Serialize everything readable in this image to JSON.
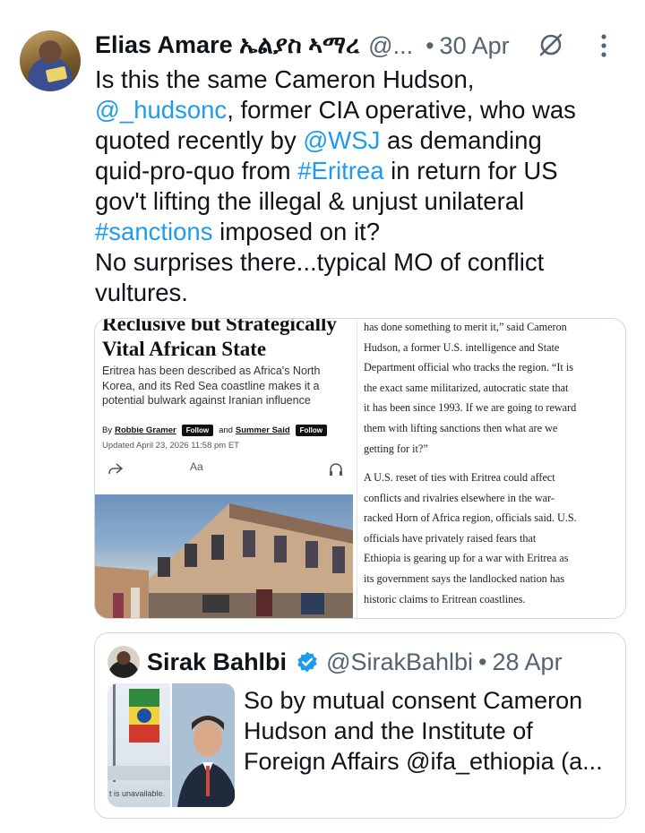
{
  "tweet": {
    "author_name": "Elias Amare ኤልያስ ኣማረ",
    "handle": "@...",
    "separator": "•",
    "date": "30 Apr",
    "text_lines": [
      [
        {
          "t": "Is this the same Cameron Hudson,",
          "link": false
        }
      ],
      [
        {
          "t": "@_hudsonc",
          "link": true
        },
        {
          "t": ", former CIA operative, who was",
          "link": false
        }
      ],
      [
        {
          "t": "quoted recently by ",
          "link": false
        },
        {
          "t": "@WSJ",
          "link": true
        },
        {
          "t": " as demanding",
          "link": false
        }
      ],
      [
        {
          "t": "quid-pro-quo from ",
          "link": false
        },
        {
          "t": "#Eritrea",
          "link": true
        },
        {
          "t": " in return for  US",
          "link": false
        }
      ],
      [
        {
          "t": "gov't lifting the illegal & unjust unilateral",
          "link": false
        }
      ],
      [
        {
          "t": "#sanctions",
          "link": true
        },
        {
          "t": " imposed on it?",
          "link": false
        }
      ],
      [
        {
          "t": "No surprises there...typical MO of conflict",
          "link": false
        }
      ],
      [
        {
          "t": "vultures.",
          "link": false
        }
      ]
    ],
    "link_color": "#1d9bf0"
  },
  "media": {
    "left": {
      "headline_lines": [
        "Reclusive but Strategically",
        "Vital African State"
      ],
      "dek": "Eritrea has been described as Africa's North Korea, and its Red Sea coastline makes it a potential bulwark against Iranian influence",
      "by_label": "By",
      "author1": "Robbie Gramer",
      "follow_label": "Follow",
      "and_label": "and",
      "author2": "Summer Said",
      "updated": "Updated April 23, 2026 11:58 pm ET",
      "text_size_label": "Aa"
    },
    "right": {
      "paragraph1": [
        "has done something to merit it,” said Cameron",
        "Hudson, a former U.S. intelligence and State",
        "Department official who tracks the region. “It is",
        "the exact same militarized, autocratic state that",
        "it has been since 1993. If we are going to reward",
        "them with lifting sanctions then what are we",
        "getting for it?”"
      ],
      "paragraph2": [
        "A U.S. reset of ties with Eritrea could affect",
        "conflicts and rivalries elsewhere in the war-",
        "racked Horn of Africa region, officials said. U.S.",
        "officials have privately raised fears that",
        "Ethiopia is gearing up for a war with Eritrea as",
        "its government says the landlocked nation has",
        "historic claims to Eritrean coastlines."
      ]
    }
  },
  "quote": {
    "author_name": "Sirak Bahlbi",
    "handle": "@SirakBahlbi",
    "separator": "•",
    "date": "28 Apr",
    "thumb_notice": "t is unavailable.",
    "text_lines": [
      "So by mutual consent Cameron",
      "Hudson and the Institute of",
      "Foreign Affairs @ifa_ethiopia (a..."
    ],
    "verified_color": "#1d9bf0"
  }
}
